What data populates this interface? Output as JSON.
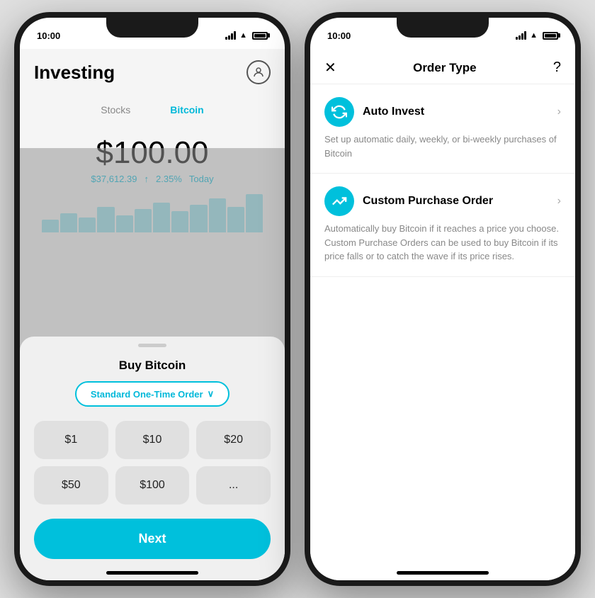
{
  "left_phone": {
    "status_bar": {
      "time": "10:00"
    },
    "header": {
      "title": "Investing",
      "profile_label": "profile"
    },
    "tabs": [
      {
        "label": "Stocks",
        "active": false
      },
      {
        "label": "Bitcoin",
        "active": true
      }
    ],
    "price": {
      "main": "$100.00",
      "sub_price": "$37,612.39",
      "change": "2.35%",
      "period": "Today"
    },
    "bottom_sheet": {
      "title": "Buy Bitcoin",
      "order_type": "Standard One-Time Order",
      "order_type_chevron": "⌄",
      "amounts": [
        "$1",
        "$10",
        "$20",
        "$50",
        "$100",
        "..."
      ],
      "next_btn": "Next"
    }
  },
  "right_phone": {
    "status_bar": {
      "time": "10:00"
    },
    "modal": {
      "close_label": "✕",
      "title": "Order Type",
      "help_label": "?",
      "options": [
        {
          "icon_symbol": "↻",
          "name": "Auto Invest",
          "description": "Set up automatic daily, weekly, or bi-weekly purchases of Bitcoin"
        },
        {
          "icon_symbol": "⤴",
          "name": "Custom Purchase Order",
          "description": "Automatically buy Bitcoin if it reaches a price you choose. Custom Purchase Orders can be used to buy Bitcoin if its price falls or to catch the wave if its price rises."
        }
      ]
    }
  },
  "icons": {
    "chevron_right": "›",
    "arrow_up": "↑",
    "chevron_down": "∨"
  }
}
